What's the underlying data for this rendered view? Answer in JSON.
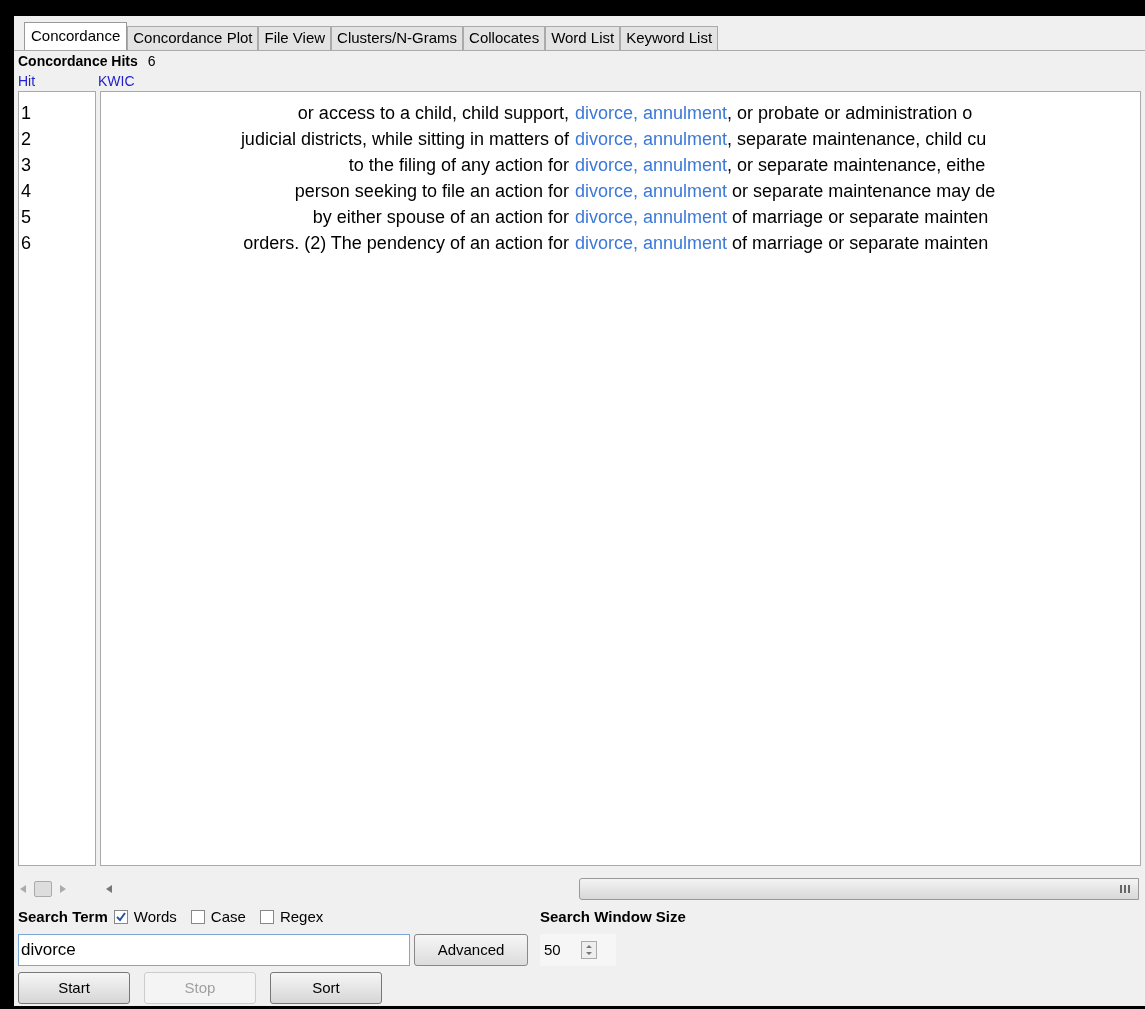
{
  "tabs": [
    {
      "label": "Concordance",
      "selected": true
    },
    {
      "label": "Concordance Plot",
      "selected": false
    },
    {
      "label": "File View",
      "selected": false
    },
    {
      "label": "Clusters/N-Grams",
      "selected": false
    },
    {
      "label": "Collocates",
      "selected": false
    },
    {
      "label": "Word List",
      "selected": false
    },
    {
      "label": "Keyword List",
      "selected": false
    }
  ],
  "hits": {
    "label": "Concordance Hits",
    "count": "6"
  },
  "columns": [
    "Hit",
    "KWIC"
  ],
  "rows": [
    {
      "hit": "1",
      "before": "or access to a child, child support,",
      "keyword": "divorce, annulment",
      "after": ", or probate or administration o"
    },
    {
      "hit": "2",
      "before": "judicial districts, while sitting in matters of",
      "keyword": "divorce, annulment",
      "after": ", separate maintenance, child cu"
    },
    {
      "hit": "3",
      "before": "to the filing of any action for",
      "keyword": "divorce, annulment",
      "after": ", or separate maintenance, eithe"
    },
    {
      "hit": "4",
      "before": "person seeking to file an action for",
      "keyword": "divorce, annulment",
      "after": " or separate maintenance may de"
    },
    {
      "hit": "5",
      "before": "by either spouse of an action for",
      "keyword": "divorce, annulment",
      "after": " of marriage or separate mainten"
    },
    {
      "hit": "6",
      "before": "orders. (2)  The pendency of an action for",
      "keyword": "divorce, annulment",
      "after": " of marriage or separate mainten"
    }
  ],
  "search": {
    "label": "Search Term",
    "options": [
      {
        "label": "Words",
        "checked": true
      },
      {
        "label": "Case",
        "checked": false
      },
      {
        "label": "Regex",
        "checked": false
      }
    ],
    "value": "divorce",
    "advanced": "Advanced"
  },
  "window_size": {
    "label": "Search Window Size",
    "value": "50"
  },
  "buttons": [
    {
      "label": "Start",
      "disabled": false
    },
    {
      "label": "Stop",
      "disabled": true
    },
    {
      "label": "Sort",
      "disabled": false
    }
  ]
}
